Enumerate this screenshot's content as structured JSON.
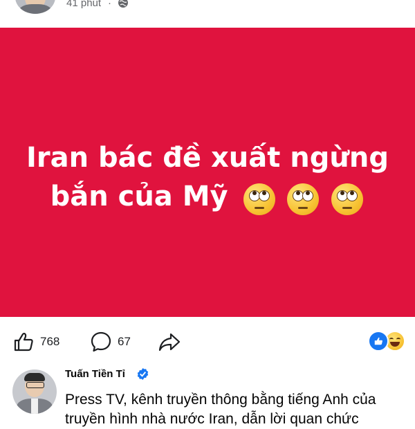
{
  "post": {
    "time": "41 phút",
    "separator": "·",
    "privacy_icon": "globe-icon"
  },
  "banner": {
    "line1": "Iran bác đề xuất ngừng",
    "line2": "bắn của Mỹ",
    "emojis": [
      "face-with-rolling-eyes",
      "face-with-rolling-eyes",
      "face-with-rolling-eyes"
    ],
    "background": "#e0133e"
  },
  "actions": {
    "like_count": "768",
    "comment_count": "67",
    "like_icon": "thumbs-up-icon",
    "comment_icon": "comment-bubble-icon",
    "share_icon": "share-arrow-icon",
    "reactions": [
      "like-reaction-icon",
      "haha-reaction-icon"
    ]
  },
  "comment": {
    "author": "Tuấn Tiền Tỉ",
    "verified": true,
    "text_line1": "Press TV, kênh truyền thông bằng tiếng Anh của",
    "text_line2": "truyền hình nhà nước Iran, dẫn lời quan chức"
  },
  "colors": {
    "accent": "#1877f2",
    "meta_text": "#65676b"
  }
}
